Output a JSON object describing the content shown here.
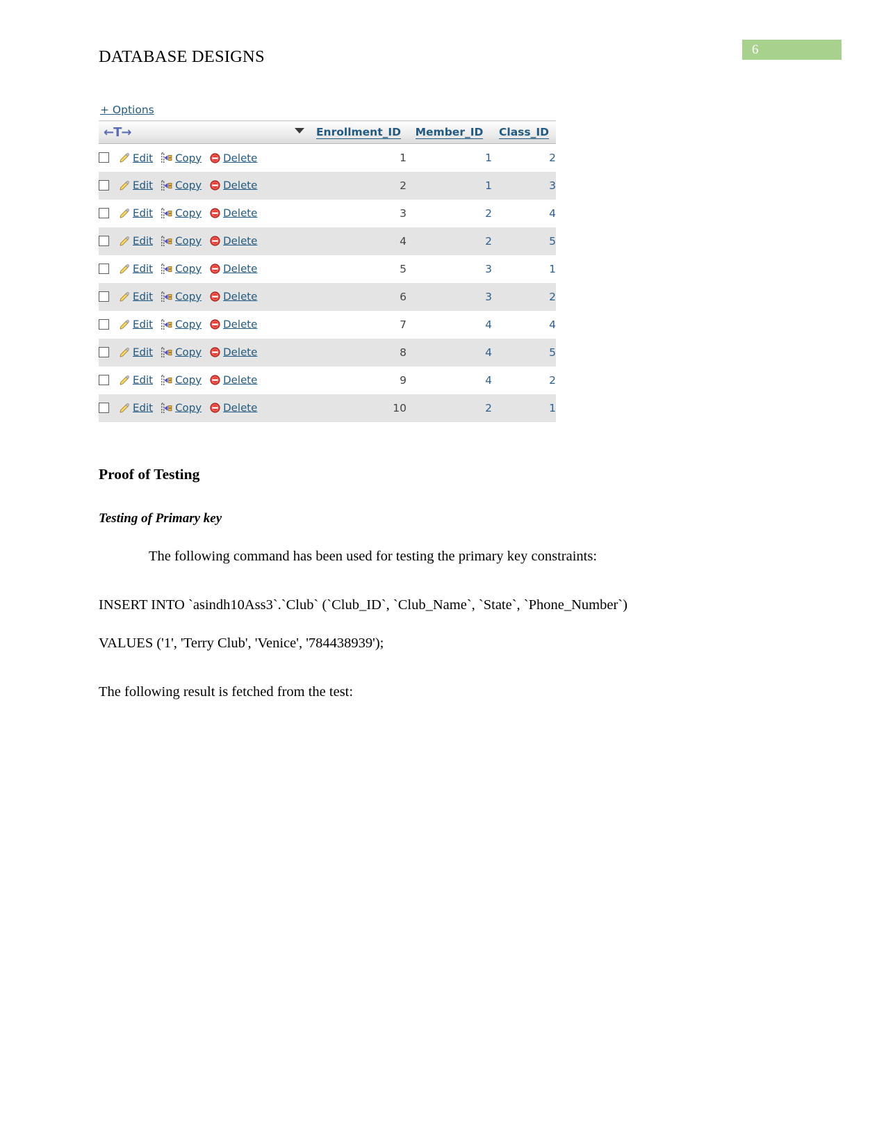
{
  "header": {
    "document_title": "DATABASE DESIGNS",
    "page_number": "6",
    "badge_color": "#a9d18e"
  },
  "result_table": {
    "options_label": "+ Options",
    "sort_control": "←T→",
    "columns": [
      "Enrollment_ID",
      "Member_ID",
      "Class_ID"
    ],
    "actions": {
      "edit_label": "Edit",
      "copy_label": "Copy",
      "delete_label": "Delete"
    },
    "rows": [
      {
        "enrollment_id": "1",
        "member_id": "1",
        "class_id": "2"
      },
      {
        "enrollment_id": "2",
        "member_id": "1",
        "class_id": "3"
      },
      {
        "enrollment_id": "3",
        "member_id": "2",
        "class_id": "4"
      },
      {
        "enrollment_id": "4",
        "member_id": "2",
        "class_id": "5"
      },
      {
        "enrollment_id": "5",
        "member_id": "3",
        "class_id": "1"
      },
      {
        "enrollment_id": "6",
        "member_id": "3",
        "class_id": "2"
      },
      {
        "enrollment_id": "7",
        "member_id": "4",
        "class_id": "4"
      },
      {
        "enrollment_id": "8",
        "member_id": "4",
        "class_id": "5"
      },
      {
        "enrollment_id": "9",
        "member_id": "4",
        "class_id": "2"
      },
      {
        "enrollment_id": "10",
        "member_id": "2",
        "class_id": "1"
      }
    ]
  },
  "content": {
    "section_title": "Proof of Testing",
    "subsection_title": "Testing of Primary key",
    "intro_paragraph": "The following command has been used for testing the primary key constraints:",
    "sql_line_1": "INSERT  INTO  `asindh10Ass3`.`Club`  (`Club_ID`,  `Club_Name`,  `State`,  `Phone_Number`)",
    "sql_line_2": "VALUES ('1', 'Terry Club', 'Venice', '784438939');",
    "closing_paragraph": "The following result is fetched from the test:"
  }
}
